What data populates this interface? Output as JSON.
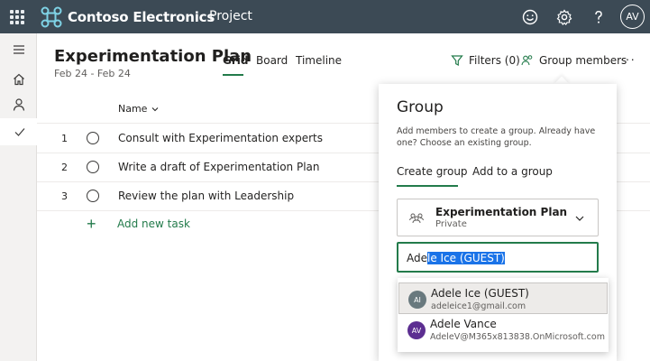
{
  "topbar": {
    "brand": "Contoso Electronics",
    "app": "Project",
    "user_initials": "AV",
    "icons": [
      "waffle-icon",
      "contoso-logo-icon",
      "smiley-icon",
      "settings-icon",
      "help-icon"
    ]
  },
  "rail": {
    "items": [
      "menu-icon",
      "home-icon",
      "person-icon",
      "check-icon"
    ]
  },
  "header": {
    "title": "Experimentation Plan",
    "dates": "Feb 24 - Feb 24",
    "tabs": [
      {
        "label": "Grid",
        "active": true
      },
      {
        "label": "Board",
        "active": false
      },
      {
        "label": "Timeline",
        "active": false
      }
    ],
    "filters_label": "Filters (0)",
    "group_members_label": "Group members",
    "more_label": "···"
  },
  "grid": {
    "column_name": "Name",
    "rows": [
      {
        "num": "1",
        "name": "Consult with Experimentation experts"
      },
      {
        "num": "2",
        "name": "Write a draft of Experimentation Plan"
      },
      {
        "num": "3",
        "name": "Review the plan with Leadership"
      }
    ],
    "add_task_label": "Add new task"
  },
  "group_panel": {
    "title": "Group",
    "description": "Add members to create a group. Already have one? Choose an existing group.",
    "tabs": [
      {
        "label": "Create group",
        "active": true
      },
      {
        "label": "Add to a group",
        "active": false
      }
    ],
    "selected_group": {
      "name": "Experimentation Plan",
      "privacy": "Private"
    },
    "search": {
      "typed": "Ade",
      "autocomplete_selected": "le Ice (GUEST)"
    },
    "suggestions": [
      {
        "initials": "AI",
        "name": "Adele Ice (GUEST)",
        "email": "adeleice1@gmail.com",
        "color": "#69797e",
        "highlighted": true
      },
      {
        "initials": "AV",
        "name": "Adele Vance",
        "email": "AdeleV@M365x813838.OnMicrosoft.com",
        "color": "#5c2e91",
        "highlighted": false
      }
    ]
  },
  "colors": {
    "topbar": "#3c4a55",
    "accent": "#237b4b",
    "selection": "#1a73e8"
  }
}
